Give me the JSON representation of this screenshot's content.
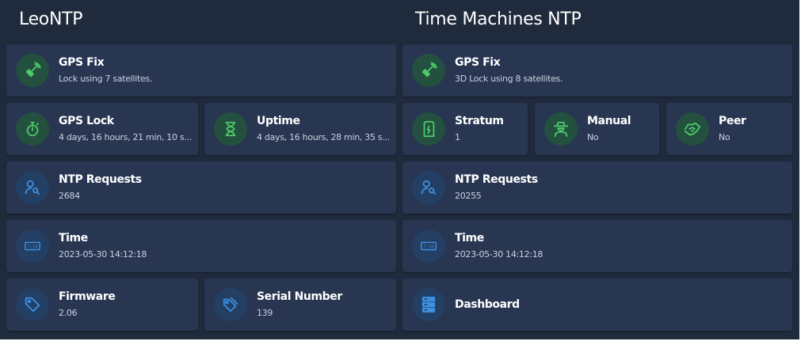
{
  "colors": {
    "background": "#1f2a3c",
    "card": "#283652",
    "green_icon": "#4ec96a",
    "blue_icon": "#3d8fe0"
  },
  "left": {
    "title": "LeoNTP",
    "cards": {
      "gps_fix": {
        "title": "GPS Fix",
        "value": "Lock using 7 satellites.",
        "icon": "satellite-icon"
      },
      "gps_lock": {
        "title": "GPS Lock",
        "value": "4 days, 16 hours, 21 min, 10 s...",
        "icon": "timer-icon"
      },
      "uptime": {
        "title": "Uptime",
        "value": "4 days, 16 hours, 28 min, 35 s...",
        "icon": "hourglass-icon"
      },
      "ntp_requests": {
        "title": "NTP Requests",
        "value": "2684",
        "icon": "user-search-icon"
      },
      "time": {
        "title": "Time",
        "value": "2023-05-30 14:12:18",
        "icon": "clock-display-icon"
      },
      "firmware": {
        "title": "Firmware",
        "value": "2.06",
        "icon": "tag-icon"
      },
      "serial": {
        "title": "Serial Number",
        "value": "139",
        "icon": "tags-icon"
      }
    }
  },
  "right": {
    "title": "Time Machines NTP",
    "cards": {
      "gps_fix": {
        "title": "GPS Fix",
        "value": "3D Lock using 8 satellites.",
        "icon": "satellite-icon"
      },
      "stratum": {
        "title": "Stratum",
        "value": "1",
        "icon": "sd-card-icon"
      },
      "manual": {
        "title": "Manual",
        "value": "No",
        "icon": "cowboy-icon"
      },
      "peer": {
        "title": "Peer",
        "value": "No",
        "icon": "handshake-icon"
      },
      "ntp_requests": {
        "title": "NTP Requests",
        "value": "20255",
        "icon": "user-search-icon"
      },
      "time": {
        "title": "Time",
        "value": "2023-05-30 14:12:18",
        "icon": "clock-display-icon"
      },
      "dashboard": {
        "title": "Dashboard",
        "icon": "server-icon"
      }
    }
  }
}
